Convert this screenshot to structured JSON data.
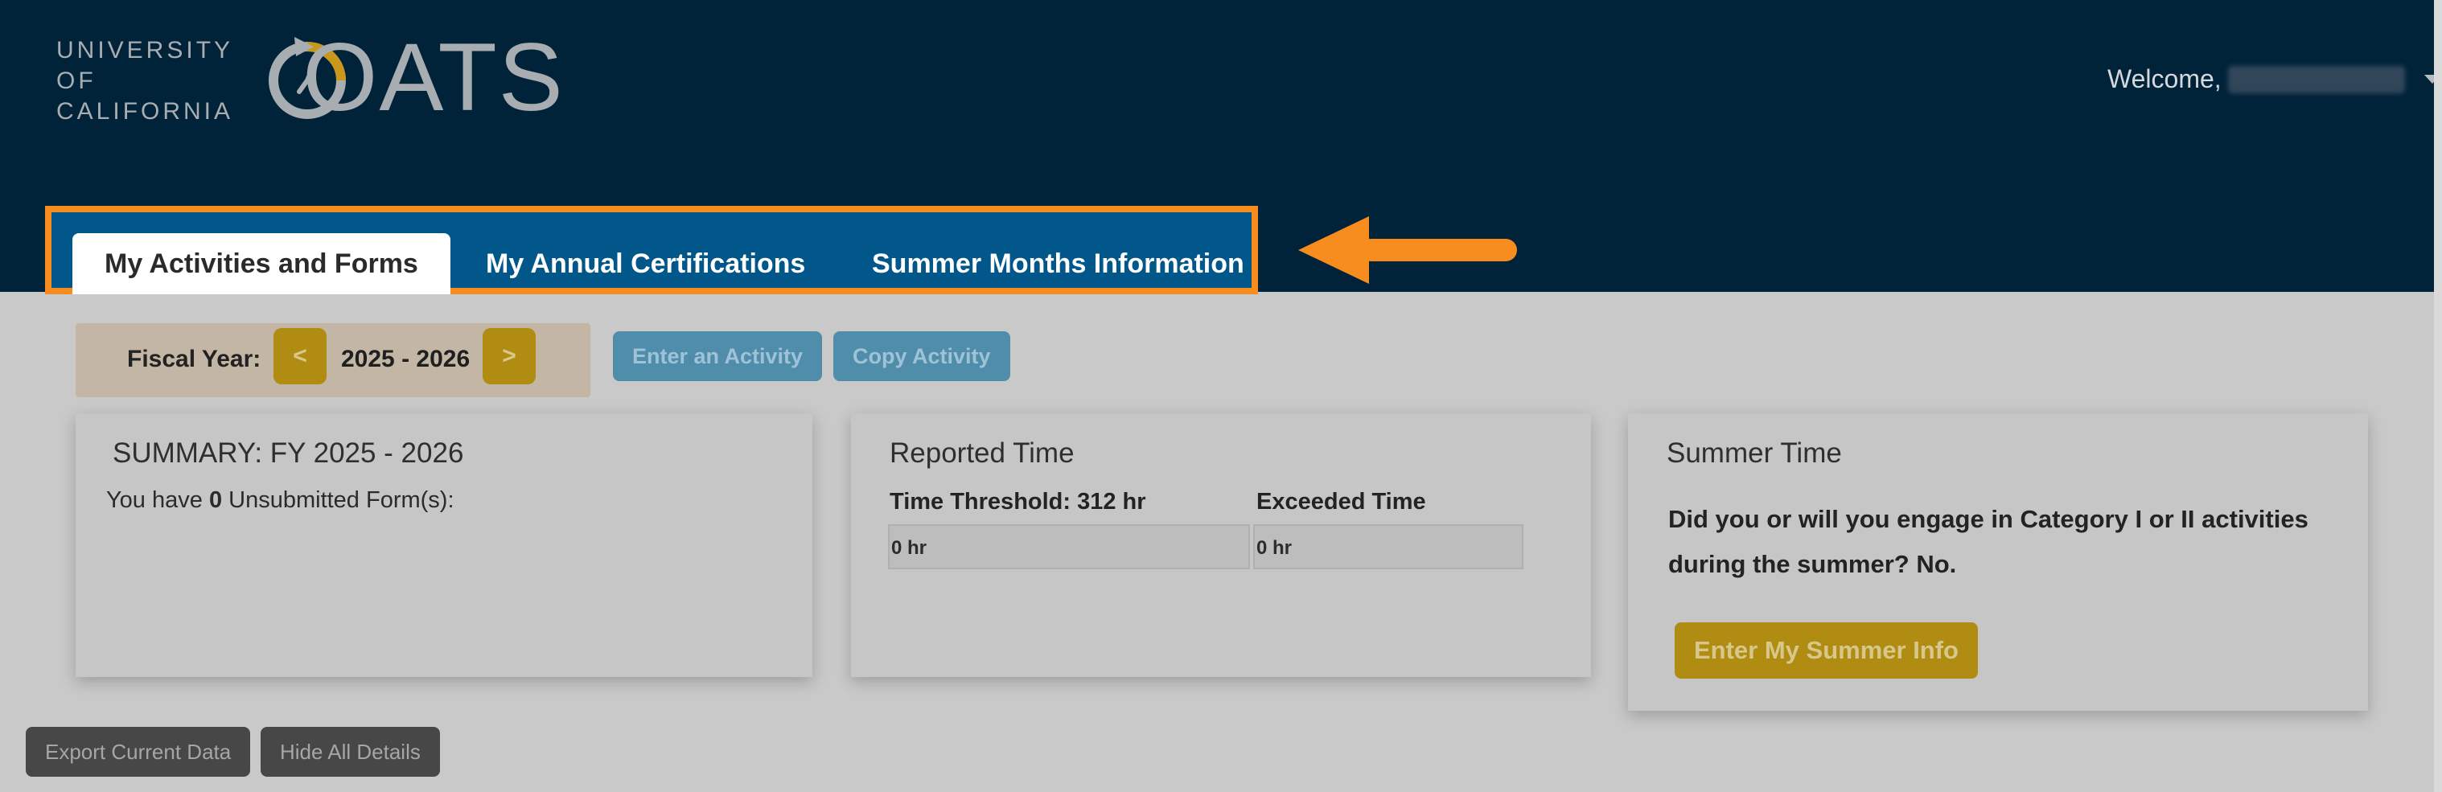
{
  "header": {
    "uc_logo_lines": [
      "UNIVERSITY",
      "OF",
      "CALIFORNIA"
    ],
    "app_logo": "OATS",
    "welcome_text": "Welcome,"
  },
  "tabs": [
    {
      "label": "My Activities and Forms",
      "active": true
    },
    {
      "label": "My Annual Certifications",
      "active": false
    },
    {
      "label": "Summer Months Information",
      "active": false
    }
  ],
  "fiscal_year": {
    "label": "Fiscal Year:",
    "prev": "<",
    "value": "2025 - 2026",
    "next": ">"
  },
  "actions": {
    "enter_activity": "Enter an Activity",
    "copy_activity": "Copy Activity"
  },
  "summary": {
    "title": "SUMMARY: FY 2025 - 2026",
    "prefix": "You have ",
    "count": "0",
    "suffix": " Unsubmitted Form(s):"
  },
  "reported_time": {
    "title": "Reported Time",
    "threshold_label": "Time Threshold: 312 hr",
    "threshold_value": "0 hr",
    "exceeded_label": "Exceeded Time",
    "exceeded_value": "0 hr"
  },
  "summer_time": {
    "title": "Summer Time",
    "question": "Did you or will you engage in Category I or II activities during the summer?",
    "answer": "No",
    "period": ".",
    "button": "Enter My Summer Info"
  },
  "footer": {
    "export": "Export Current Data",
    "hide": "Hide All Details"
  },
  "colors": {
    "header_bg": "#00233a",
    "tab_bar": "#01578a",
    "highlight_orange": "#f78d1e",
    "gold": "#b08c12",
    "overlay_gray": "#c9c9c9"
  }
}
